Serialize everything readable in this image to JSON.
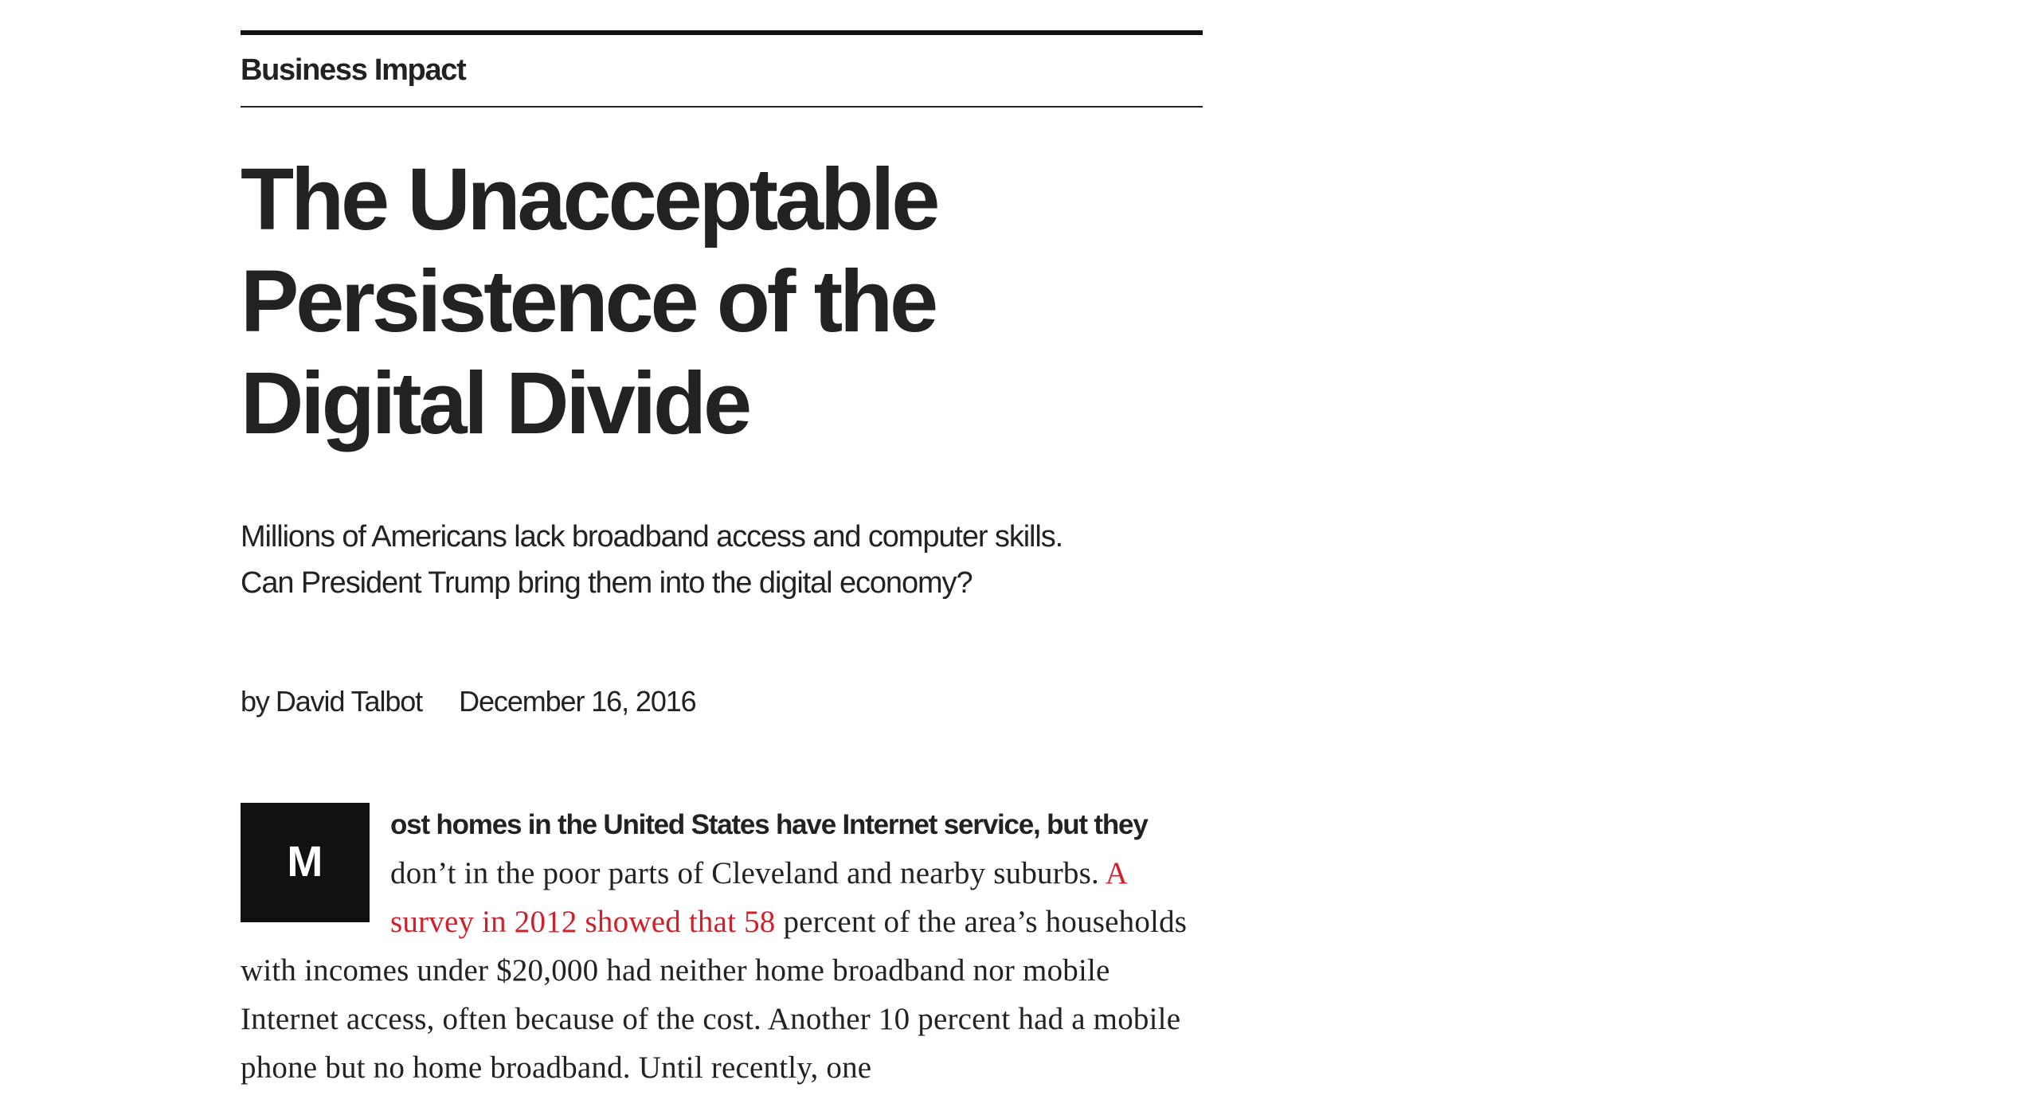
{
  "article": {
    "section": "Business Impact",
    "headline": "The Unacceptable Persistence of the Digital Divide",
    "dek": "Millions of Americans lack broadband access and computer skills. Can President Trump bring them into the digital economy?",
    "byline": {
      "prefix": "by",
      "author": "David Talbot",
      "date": "December 16, 2016"
    },
    "body": {
      "drop_cap": "M",
      "lead_in": "ost homes in the United States have Internet service, but they",
      "text_1": " don’t in the poor parts of Cleveland and nearby suburbs. ",
      "link_text": "A survey in 2012 showed that 58",
      "text_2": " percent of the area’s households with incomes under $20,000 had neither home broadband nor mobile Internet access, often because of the cost. Another 10 percent had a mobile phone but no home broadband. Until recently, one"
    }
  },
  "colors": {
    "text": "#222222",
    "link": "#d0202a",
    "drop_cap_bg": "#111111",
    "drop_cap_fg": "#ffffff"
  }
}
